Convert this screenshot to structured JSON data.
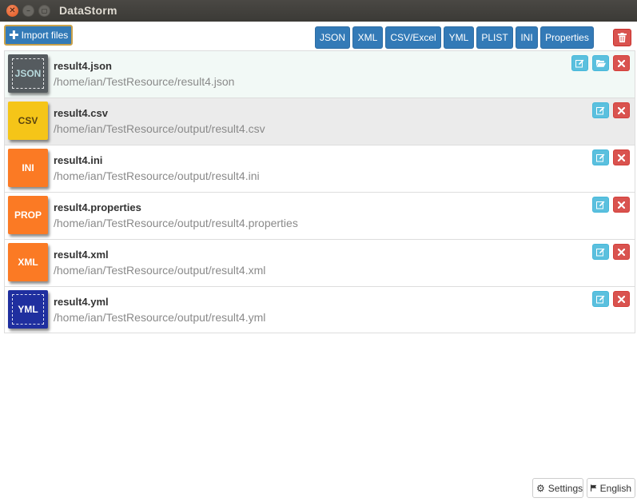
{
  "window": {
    "title": "DataStorm"
  },
  "toolbar": {
    "import_label": "Import files",
    "formats": [
      "JSON",
      "XML",
      "CSV/Excel",
      "YML",
      "PLIST",
      "INI",
      "Properties"
    ]
  },
  "files": [
    {
      "badge": "JSON",
      "name": "result4.json",
      "path": "/home/ian/TestResource/result4.json"
    },
    {
      "badge": "CSV",
      "name": "result4.csv",
      "path": "/home/ian/TestResource/output/result4.csv"
    },
    {
      "badge": "INI",
      "name": "result4.ini",
      "path": "/home/ian/TestResource/output/result4.ini"
    },
    {
      "badge": "PROP",
      "name": "result4.properties",
      "path": "/home/ian/TestResource/output/result4.properties"
    },
    {
      "badge": "XML",
      "name": "result4.xml",
      "path": "/home/ian/TestResource/output/result4.xml"
    },
    {
      "badge": "YML",
      "name": "result4.yml",
      "path": "/home/ian/TestResource/output/result4.yml"
    }
  ],
  "footer": {
    "settings_label": "Settings",
    "language_label": "English"
  },
  "colors": {
    "primary": "#337ab7",
    "info": "#5bc0de",
    "danger": "#d9534f",
    "selected_row": "#f2f9f6"
  }
}
